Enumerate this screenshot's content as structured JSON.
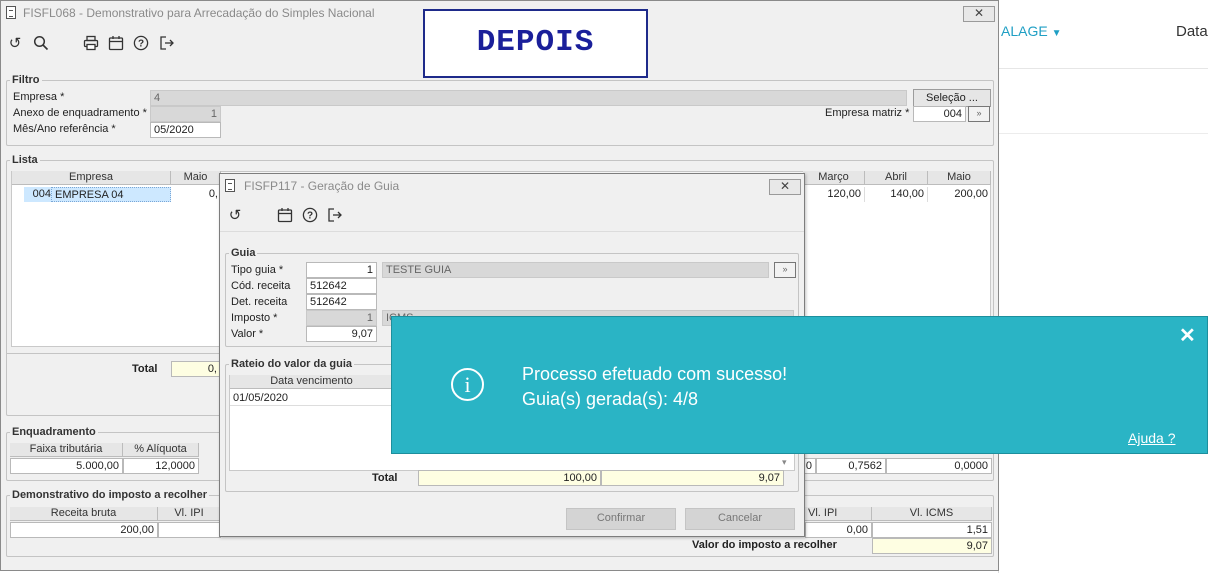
{
  "bg_page": {
    "menu_label": "ALAGE",
    "column_label": "Data"
  },
  "depois_label": "DEPOIS",
  "main_window": {
    "title": "FISFL068 - Demonstrativo para Arrecadação do Simples Nacional",
    "close": "✕",
    "filtro": {
      "legend": "Filtro",
      "empresa_label": "Empresa *",
      "empresa_value": "4",
      "anexo_label": "Anexo de enquadramento *",
      "anexo_value": "1",
      "mes_label": "Mês/Ano referência *",
      "mes_value": "05/2020",
      "selecao_button": "Seleção ...",
      "matriz_label": "Empresa matriz *",
      "matriz_value": "004"
    },
    "lista": {
      "legend": "Lista",
      "headers": [
        "Empresa",
        "Maio",
        "Março",
        "Abril",
        "Maio"
      ],
      "row": {
        "code": "004",
        "name": "EMPRESA 04",
        "maio": "0,",
        "marco": "120,00",
        "abril": "140,00",
        "maio2": "200,00"
      },
      "total_label": "Total",
      "total_value": "0,"
    },
    "enquadramento": {
      "legend": "Enquadramento",
      "headers": [
        "Faixa tributária",
        "% Alíquota"
      ],
      "values": [
        "5.000,00",
        "12,0000"
      ],
      "right_values": [
        "0",
        "0,7562",
        "0,0000"
      ]
    },
    "demonstrativo": {
      "legend": "Demonstrativo do imposto a recolher",
      "headers": [
        "Receita bruta",
        "Vl. IPI",
        "Vl. IPI",
        "Vl. ICMS"
      ],
      "values": [
        "200,00",
        "0,00",
        "1,51"
      ],
      "total_label": "Valor do imposto a recolher",
      "total_value": "9,07"
    }
  },
  "dialog": {
    "title": "FISFP117 - Geração de Guia",
    "close": "✕",
    "guia": {
      "legend": "Guia",
      "tipo_label": "Tipo guia *",
      "tipo_value": "1",
      "tipo_desc": "TESTE GUIA",
      "cod_label": "Cód. receita",
      "cod_value": "512642",
      "det_label": "Det. receita",
      "det_value": "512642",
      "imposto_label": "Imposto *",
      "imposto_value": "1",
      "imposto_desc": "ICMS",
      "valor_label": "Valor *",
      "valor_value": "9,07"
    },
    "rateio": {
      "legend": "Rateio do valor da guia",
      "header": "Data vencimento",
      "row_date": "01/05/2020",
      "total_label": "Total",
      "total1": "100,00",
      "total2": "9,07"
    },
    "confirmar": "Confirmar",
    "cancelar": "Cancelar"
  },
  "notification": {
    "line1": "Processo efetuado com sucesso!",
    "line2": "Guia(s) gerada(s): 4/8",
    "help": "Ajuda ?",
    "close": "✕",
    "color": "#2ab4c5"
  }
}
